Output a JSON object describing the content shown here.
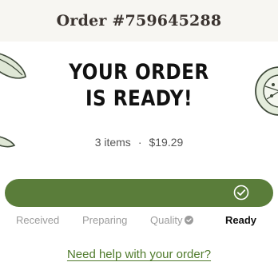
{
  "header": {
    "title": "Order #759645288"
  },
  "hero": {
    "headline_line1": "YOUR ORDER",
    "headline_line2": "IS READY!",
    "decorations": [
      "leaf-illustration",
      "tomato-slice-illustration"
    ]
  },
  "summary": {
    "items": "3 items",
    "separator": "·",
    "total": "$19.29"
  },
  "progress": {
    "level": 1.0,
    "color": "#5a7d3a",
    "icon": "check-circle-icon"
  },
  "steps": [
    {
      "label": "Received",
      "state": "done"
    },
    {
      "label": "Preparing",
      "state": "done"
    },
    {
      "label": "Quality",
      "state": "done",
      "icon": "verified-badge-icon"
    },
    {
      "label": "Ready",
      "state": "current"
    }
  ],
  "help": {
    "link_text": "Need help with your order?",
    "color": "#4f7a2c"
  }
}
